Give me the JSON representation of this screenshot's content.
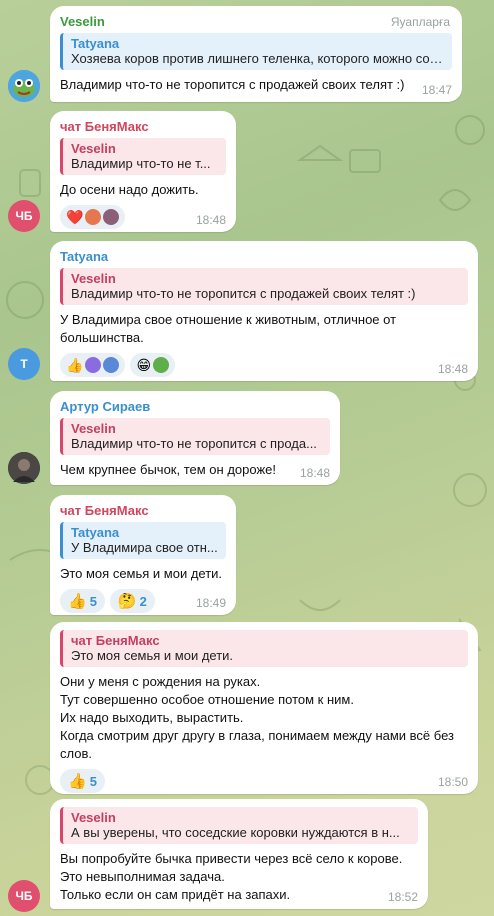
{
  "messages": [
    {
      "sender": "Veselin",
      "role": "Яуапларға",
      "reply_name": "Tatyana",
      "reply_text": "Хозяева коров против лишнего теленка, которого можно сохранить",
      "text": "Владимир что-то не торопится с продажей своих телят :)",
      "time": "18:47",
      "avatar": "pepe-avatar"
    },
    {
      "sender": "чат БеняМакс",
      "reply_name": "Veselin",
      "reply_text": "Владимир что-то не т...",
      "text": "До осени надо дожить.",
      "time": "18:48",
      "avatar_text": "ЧБ",
      "reactions": [
        "❤️"
      ]
    },
    {
      "sender": "Tatyana",
      "reply_name": "Veselin",
      "reply_text": "Владимир что-то не торопится с продажей своих телят :)",
      "text": "У Владимира свое отношение к животным, отличное от большинства.",
      "time": "18:48",
      "avatar_text": "T",
      "reactions": [
        "👍",
        "😁"
      ]
    },
    {
      "sender": "Артур Сираев",
      "reply_name": "Veselin",
      "reply_text": "Владимир что-то не торопится с прода...",
      "text": "Чем крупнее бычок, тем он дороже!",
      "time": "18:48"
    },
    {
      "sender": "чат БеняМакс",
      "reply_name": "Tatyana",
      "reply_text": "У Владимира свое отн...",
      "text": "Это моя семья и мои дети.",
      "time": "18:49",
      "reactions": [
        {
          "emoji": "👍",
          "count": "5"
        },
        {
          "emoji": "🤔",
          "count": "2"
        }
      ]
    },
    {
      "reply_name": "чат БеняМакс",
      "reply_text": "Это моя семья и мои дети.",
      "lines": [
        "Они у меня с рождения на руках.",
        "Тут совершенно особое отношение потом к ним.",
        "Их надо выходить, вырастить.",
        "Когда смотрим друг другу в глаза, понимаем между нами всё без слов."
      ],
      "time": "18:50",
      "reactions": [
        {
          "emoji": "👍",
          "count": "5"
        }
      ]
    },
    {
      "reply_name": "Veselin",
      "reply_text": "А вы уверены, что соседские коровки нуждаются в н...",
      "lines": [
        "Вы попробуйте бычка привести через всё село к корове.",
        "Это невыполнимая задача.",
        "Только если он сам придёт на запахи."
      ],
      "time": "18:52",
      "avatar_text": "ЧБ"
    }
  ]
}
